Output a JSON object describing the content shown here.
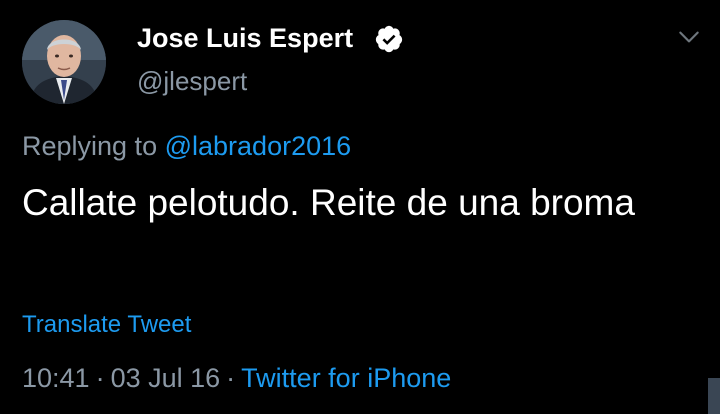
{
  "tweet": {
    "author": {
      "display_name": "Jose Luis Espert",
      "handle": "@jlespert",
      "verified": true,
      "avatar_icon": "profile-photo"
    },
    "reply": {
      "prefix": "Replying to",
      "mention": "@labrador2016"
    },
    "text": "Callate pelotudo. Reite de una broma",
    "translate_label": "Translate Tweet",
    "time": "10:41",
    "date": "03 Jul 16",
    "separator": "·",
    "source": "Twitter for iPhone"
  },
  "colors": {
    "background": "#000000",
    "primary_text": "#ffffff",
    "secondary_text": "#8b98a5",
    "accent": "#1d9bf0"
  }
}
